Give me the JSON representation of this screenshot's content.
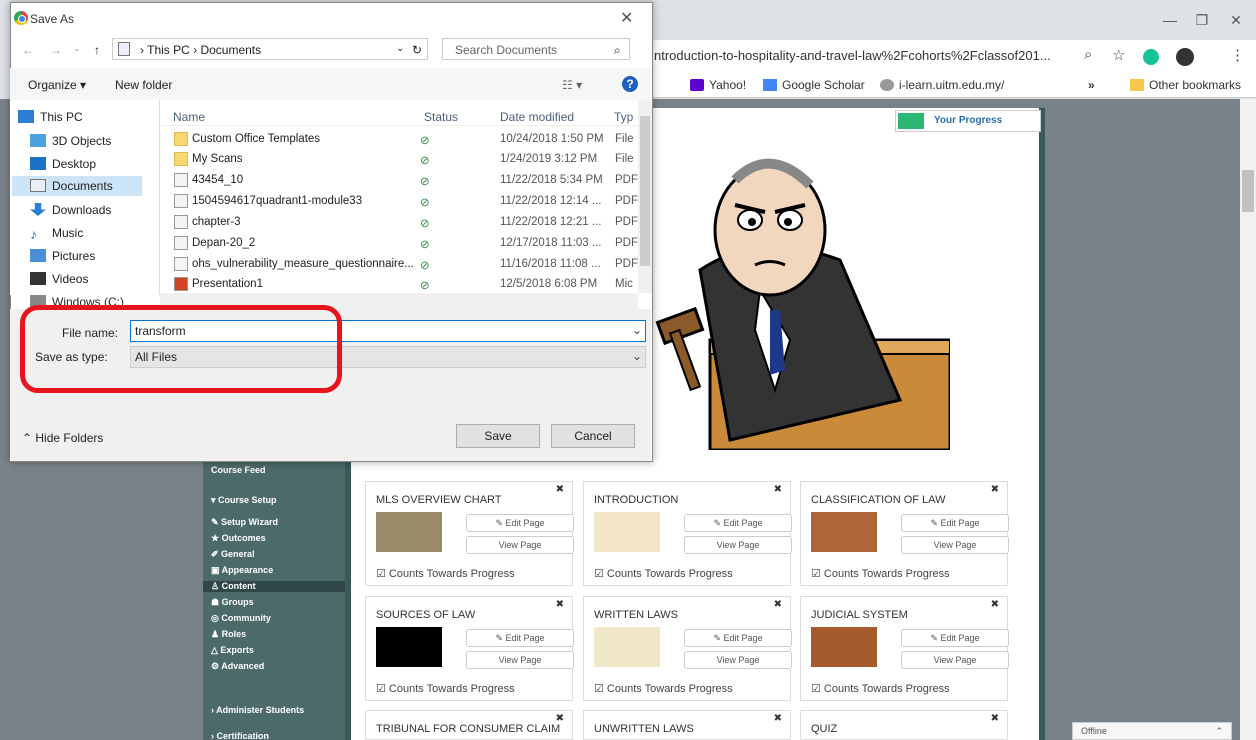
{
  "dialog": {
    "title": "Save As",
    "breadcrumb": "›  This PC  ›  Documents",
    "search_placeholder": "Search Documents",
    "organize_label": "Organize ▾",
    "new_folder_label": "New folder",
    "nav_items": [
      "This PC",
      "3D Objects",
      "Desktop",
      "Documents",
      "Downloads",
      "Music",
      "Pictures",
      "Videos",
      "Windows (C:)"
    ],
    "columns": [
      "Name",
      "Status",
      "Date modified",
      "Typ"
    ],
    "files": [
      {
        "name": "Custom Office Templates",
        "date": "10/24/2018 1:50 PM",
        "type": "File"
      },
      {
        "name": "My Scans",
        "date": "1/24/2019 3:12 PM",
        "type": "File"
      },
      {
        "name": "43454_10",
        "date": "11/22/2018 5:34 PM",
        "type": "PDF"
      },
      {
        "name": "1504594617quadrant1-module33",
        "date": "11/22/2018 12:14 ...",
        "type": "PDF"
      },
      {
        "name": "chapter-3",
        "date": "11/22/2018 12:21 ...",
        "type": "PDF"
      },
      {
        "name": "Depan-20_2",
        "date": "12/17/2018 11:03 ...",
        "type": "PDF"
      },
      {
        "name": "ohs_vulnerability_measure_questionnaire...",
        "date": "11/16/2018 11:08 ...",
        "type": "PDF"
      },
      {
        "name": "Presentation1",
        "date": "12/5/2018 6:08 PM",
        "type": "Mic"
      }
    ],
    "file_name_label": "File name:",
    "file_name_value": "transform",
    "save_type_label": "Save as type:",
    "save_type_value": "All Files",
    "hide_folders_label": "Hide Folders",
    "save_label": "Save",
    "cancel_label": "Cancel"
  },
  "browser": {
    "url": "ntroduction-to-hospitality-and-travel-law%2Fcohorts%2Fclassof201...",
    "bookmarks": [
      "Yahoo!",
      "Google Scholar",
      "i-learn.uitm.edu.my/",
      "»",
      "Other bookmarks"
    ]
  },
  "progress": {
    "label": "Your Progress",
    "fraction": 0.18
  },
  "sidebar": {
    "items": [
      "Course Feed",
      "Course Setup",
      "Setup Wizard",
      "Outcomes",
      "General",
      "Appearance",
      "Content",
      "Groups",
      "Community",
      "Roles",
      "Exports",
      "Advanced",
      "Administer Students",
      "Certification"
    ]
  },
  "tiles": [
    {
      "title": "MLS OVERVIEW CHART"
    },
    {
      "title": "INTRODUCTION"
    },
    {
      "title": "CLASSIFICATION OF LAW"
    },
    {
      "title": "SOURCES OF LAW"
    },
    {
      "title": "WRITTEN LAWS"
    },
    {
      "title": "JUDICIAL SYSTEM"
    },
    {
      "title": "TRIBUNAL FOR CONSUMER CLAIM"
    },
    {
      "title": "UNWRITTEN LAWS"
    },
    {
      "title": "QUIZ"
    }
  ],
  "tile_buttons": {
    "edit": "Edit Page",
    "view": "View Page",
    "counts": "Counts Towards Progress"
  },
  "offline_label": "Offline",
  "colors": {
    "highlight": "#e8141c",
    "progress": "#2bb673",
    "sidebar": "#4d6a6a"
  }
}
